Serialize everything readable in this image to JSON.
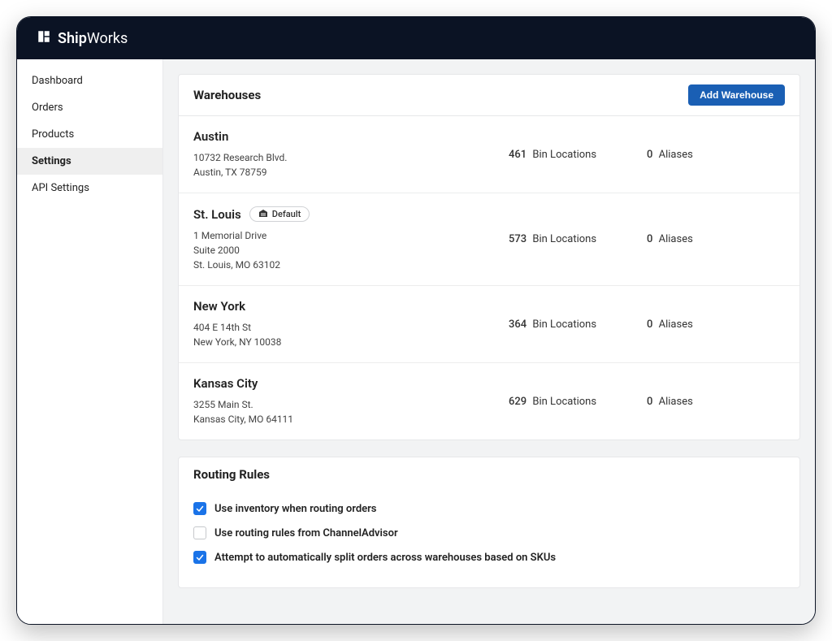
{
  "brand": {
    "name_bold": "Ship",
    "name_light": "Works"
  },
  "sidebar": {
    "items": [
      {
        "label": "Dashboard",
        "active": false
      },
      {
        "label": "Orders",
        "active": false
      },
      {
        "label": "Products",
        "active": false
      },
      {
        "label": "Settings",
        "active": true
      },
      {
        "label": "API Settings",
        "active": false
      }
    ]
  },
  "warehouses": {
    "title": "Warehouses",
    "add_button": "Add Warehouse",
    "bin_label": "Bin Locations",
    "alias_label": "Aliases",
    "default_badge": "Default",
    "items": [
      {
        "name": "Austin",
        "default": false,
        "address_lines": [
          "10732 Research Blvd.",
          "Austin, TX 78759"
        ],
        "bins": "461",
        "aliases": "0"
      },
      {
        "name": "St. Louis",
        "default": true,
        "address_lines": [
          "1 Memorial Drive",
          "Suite 2000",
          "St. Louis, MO 63102"
        ],
        "bins": "573",
        "aliases": "0"
      },
      {
        "name": "New York",
        "default": false,
        "address_lines": [
          "404 E 14th St",
          "New York, NY 10038"
        ],
        "bins": "364",
        "aliases": "0"
      },
      {
        "name": "Kansas City",
        "default": false,
        "address_lines": [
          "3255 Main St.",
          "Kansas City, MO 64111"
        ],
        "bins": "629",
        "aliases": "0"
      }
    ]
  },
  "routing": {
    "title": "Routing Rules",
    "rules": [
      {
        "label": "Use inventory when routing orders",
        "checked": true
      },
      {
        "label": "Use routing rules from ChannelAdvisor",
        "checked": false
      },
      {
        "label": "Attempt to automatically split orders across warehouses based on SKUs",
        "checked": true
      }
    ]
  }
}
